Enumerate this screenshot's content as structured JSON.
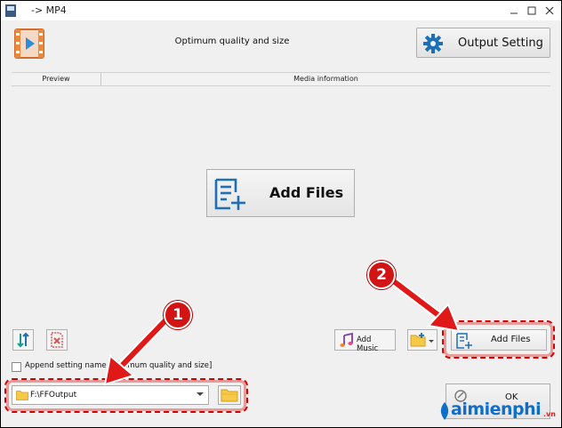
{
  "window": {
    "title": "-> MP4"
  },
  "header": {
    "profile_label": "Optimum quality and size",
    "output_setting_label": "Output Setting"
  },
  "columns": {
    "preview": "Preview",
    "media_info": "Media information"
  },
  "center": {
    "add_files_label": "Add Files"
  },
  "toolbar": {
    "add_music_label": "Add Music",
    "add_files_label": "Add Files"
  },
  "options": {
    "append_setting_label": "Append setting name [Optimum quality and size]",
    "append_checked": false
  },
  "output": {
    "folder_path": "F:\\FFOutput"
  },
  "actions": {
    "ok_label": "OK"
  },
  "annotations": {
    "badge_1": "1",
    "badge_2": "2",
    "highlight_color": "#d60000"
  },
  "watermark": {
    "brand": "aimienphi",
    "tld": ".vn",
    "brand_color": "#0f6fc8"
  },
  "colors": {
    "accent_blue": "#1e6fb4",
    "window_bg": "#f0f0f0"
  }
}
